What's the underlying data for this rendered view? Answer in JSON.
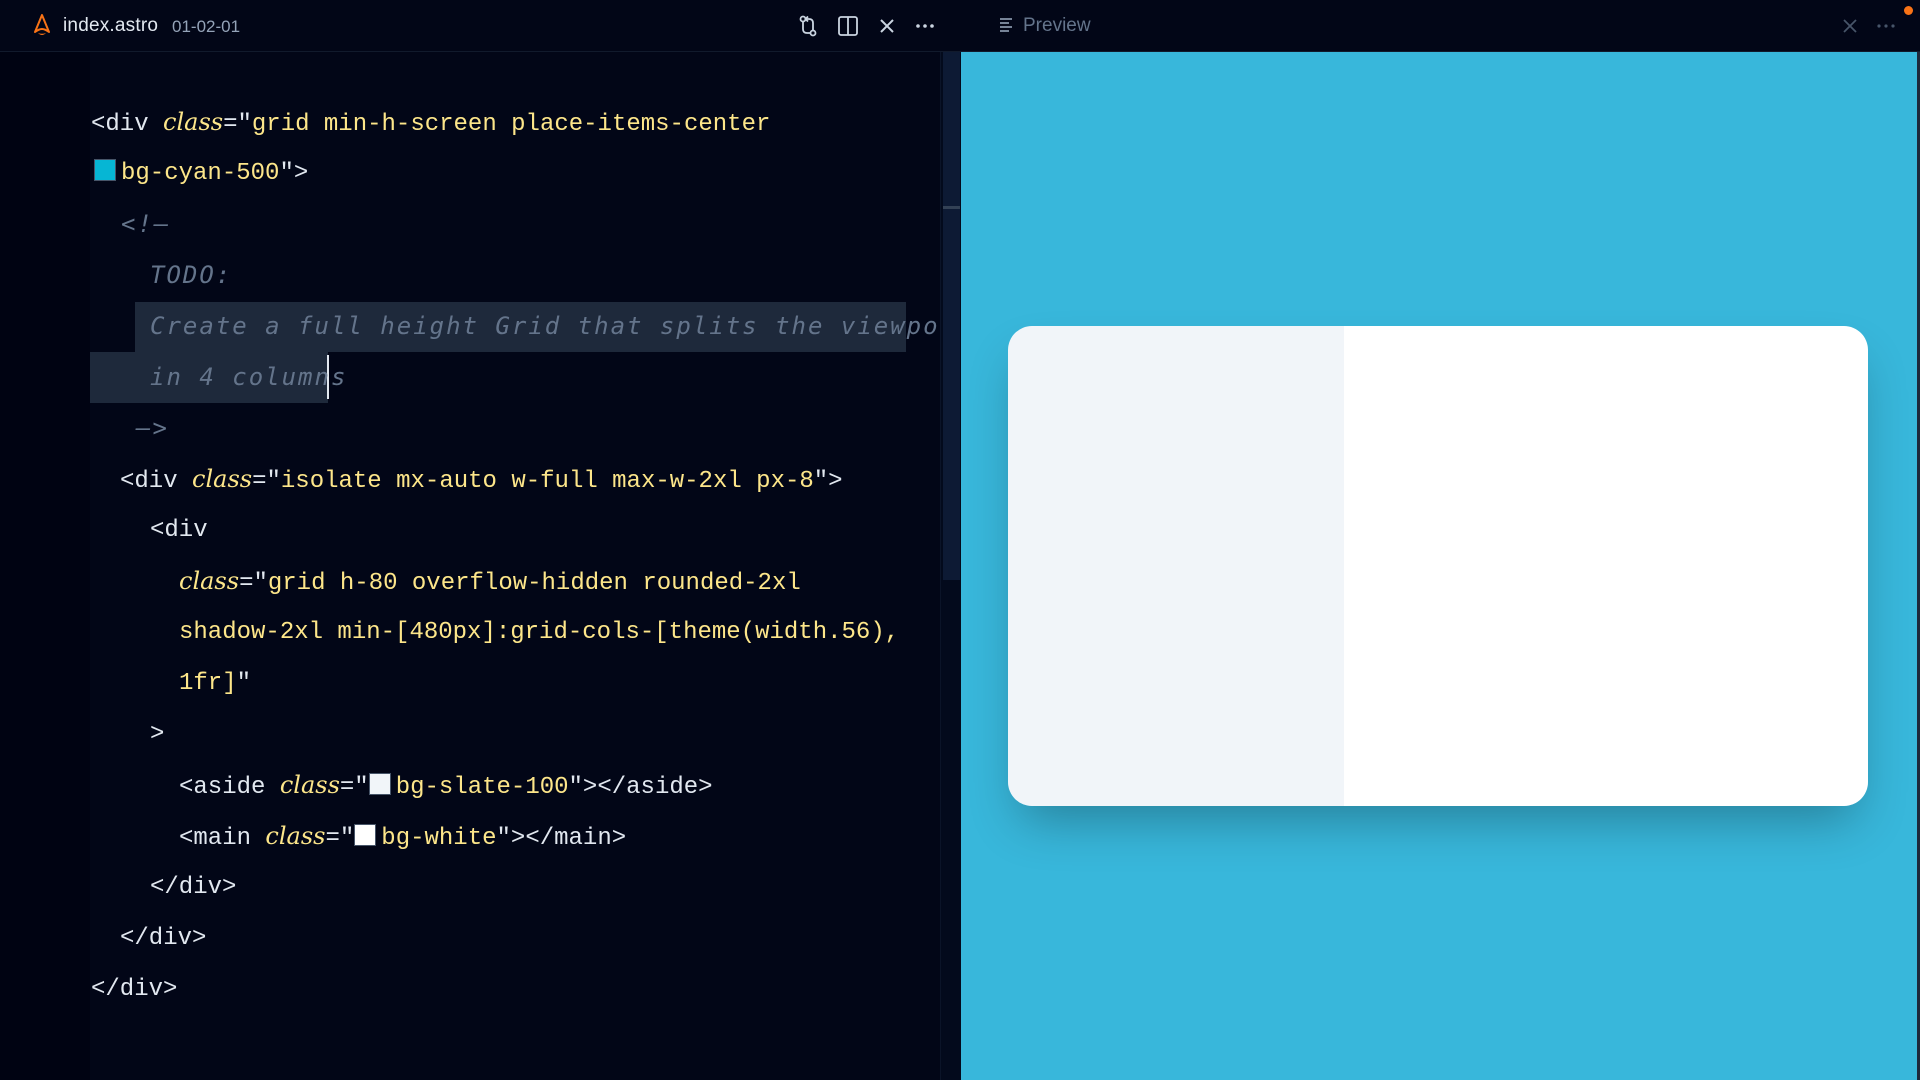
{
  "editor": {
    "tab": {
      "filename": "index.astro",
      "subtitle": "01-02-01"
    },
    "toolbar_icons": [
      "source-control-icon",
      "split-editor-icon",
      "close-icon",
      "more-icon"
    ],
    "code": {
      "l1_tag_open": "<div ",
      "l1_attr": "class",
      "l1_eq": "=\"",
      "l1_val": "grid min-h-screen place-items-center",
      "l2_val": "bg-cyan-500",
      "l2_close": "\">",
      "l2_swatch": "#06b6d4",
      "l3": "<!—",
      "l4": "TODO:",
      "l5": "Create a full height Grid that splits the viewport",
      "l6": "in 4 columns",
      "l7": "—>",
      "l8_open": "<div ",
      "l8_attr": "class",
      "l8_eq": "=\"",
      "l8_val": "isolate mx-auto w-full max-w-2xl px-8",
      "l8_close": "\">",
      "l9": "<div",
      "l10_attr": "class",
      "l10_eq": "=\"",
      "l10_val": "grid h-80 overflow-hidden rounded-2xl",
      "l11_val": "shadow-2xl min-[480px]:grid-cols-[theme(width.56),",
      "l12_val": "1fr]",
      "l12_close": "\"",
      "l13": ">",
      "l14_open": "<aside ",
      "l14_attr": "class",
      "l14_eq": "=\"",
      "l14_val": "bg-slate-100",
      "l14_close": "\"></aside>",
      "l14_swatch": "#f1f5f9",
      "l15_open": "<main ",
      "l15_attr": "class",
      "l15_eq": "=\"",
      "l15_val": "bg-white",
      "l15_close": "\"></main>",
      "l15_swatch": "#ffffff",
      "l16": "</div>",
      "l17": "</div>",
      "l18": "</div>"
    }
  },
  "preview": {
    "title": "Preview",
    "background": "#38b7db",
    "aside_color": "#f1f5f9",
    "main_color": "#ffffff"
  }
}
